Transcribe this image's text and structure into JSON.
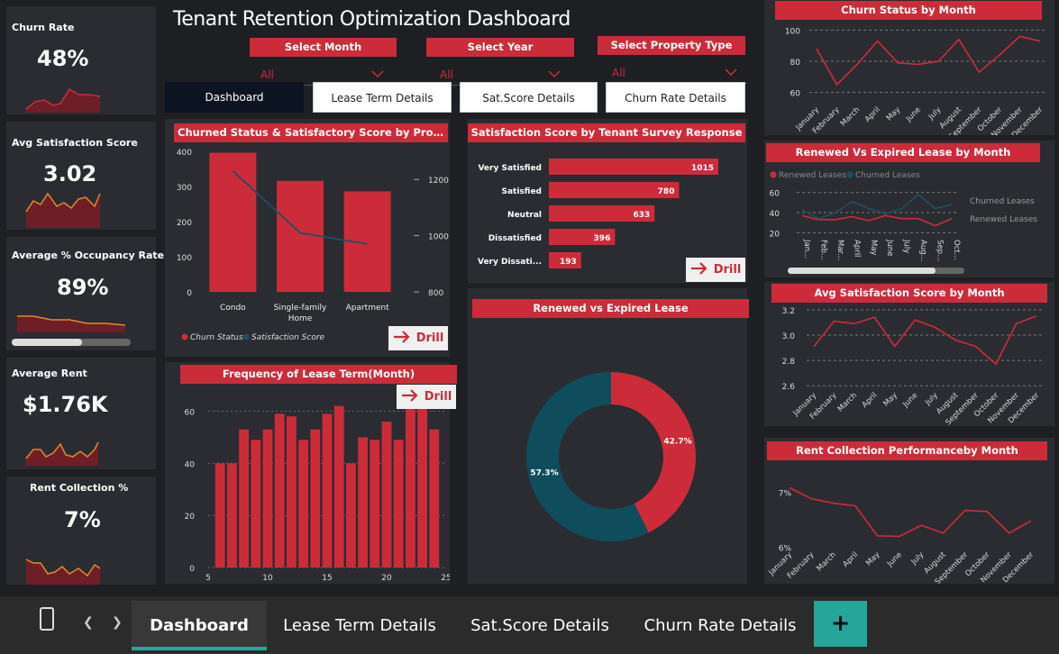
{
  "title": "Tenant Retention Optimization Dashboard",
  "filters": {
    "month": {
      "label": "Select Month",
      "value": "All"
    },
    "year": {
      "label": "Select Year",
      "value": "All"
    },
    "property": {
      "label": "Select Property Type",
      "value": "All"
    }
  },
  "nav": {
    "dashboard": "Dashboard",
    "lease": "Lease Term Details",
    "sat": "Sat.Score Details",
    "churn": "Churn Rate Details"
  },
  "kpis": {
    "churn": {
      "title": "Churn Rate",
      "value": "48%"
    },
    "sat": {
      "title": "Avg Satisfaction Score",
      "value": "3.02"
    },
    "occ": {
      "title": "Average % Occupancy Rate",
      "value": "89%"
    },
    "rent": {
      "title": "Average Rent",
      "value": "$1.76K"
    },
    "coll": {
      "title": "Rent Collection %",
      "value": "7%"
    }
  },
  "drill_label": "Drill",
  "colors": {
    "accent": "#cc2c3a",
    "teal": "#0f4c5c",
    "tab_accent": "#26a69a"
  },
  "chart_data": [
    {
      "id": "churn_sat_property",
      "type": "bar",
      "title": "Churned Status & Satisfactory Score by Property T...",
      "categories": [
        "Condo",
        "Single-family Home",
        "Apartment"
      ],
      "category_lines": [
        [
          "Condo"
        ],
        [
          "Single-family",
          "Home"
        ],
        [
          "Apartment"
        ]
      ],
      "series": [
        {
          "name": "Churn Status",
          "values": [
            396,
            316,
            286
          ],
          "color": "#cc2c3a"
        },
        {
          "name": "Satisfaction Score",
          "values": [
            1230,
            1010,
            970
          ],
          "color": "#1f4e66"
        }
      ],
      "ylim": [
        0,
        400
      ],
      "yticks": [
        "0",
        "100",
        "200",
        "300",
        "400"
      ],
      "y2lim": [
        800,
        1300
      ],
      "y2ticks": [
        "800",
        "1000",
        "1200"
      ],
      "y2tick_values": [
        800,
        1000,
        1200
      ]
    },
    {
      "id": "survey_response",
      "type": "bar",
      "title": "Satisfaction Score by Tenant Survey Response",
      "categories": [
        "Very Satisfied",
        "Satisfied",
        "Neutral",
        "Dissatisfied",
        "Very Dissati..."
      ],
      "values": [
        1015,
        780,
        633,
        396,
        193
      ],
      "labels": [
        "1015",
        "780",
        "633",
        "396",
        "193"
      ],
      "max": 1015
    },
    {
      "id": "lease_term",
      "type": "bar",
      "title": "Frequency of Lease Term(Month)",
      "x": [
        6,
        7,
        8,
        9,
        10,
        11,
        12,
        13,
        14,
        15,
        16,
        17,
        18,
        19,
        20,
        21,
        22,
        23,
        24
      ],
      "values": [
        40,
        40,
        53,
        49,
        53,
        59,
        58,
        49,
        53,
        59,
        62,
        40,
        50,
        49,
        56,
        49,
        64,
        64,
        53
      ],
      "ylim": [
        0,
        65
      ],
      "yticks": [
        "0",
        "20",
        "40",
        "60"
      ],
      "ytick_values": [
        0,
        20,
        40,
        60
      ],
      "xticks": [
        "5",
        "10",
        "15",
        "20",
        "25"
      ],
      "xtick_values": [
        5,
        10,
        15,
        20,
        25
      ]
    },
    {
      "id": "renewed_vs_expired",
      "type": "pie",
      "title": "Renewed vs Expired Lease",
      "slices": [
        {
          "value": 42.7,
          "label": "42.7%",
          "color": "#cc2c3a"
        },
        {
          "value": 57.3,
          "label": "57.3%",
          "color": "#0f4c5c"
        }
      ]
    },
    {
      "id": "churn_by_month",
      "type": "line",
      "title": "Churn Status by Month",
      "categories": [
        "January",
        "February",
        "March",
        "April",
        "May",
        "June",
        "July",
        "August",
        "September",
        "October",
        "November",
        "December"
      ],
      "values": [
        88,
        65,
        78,
        93,
        79,
        78,
        80,
        94,
        73,
        84,
        96,
        93
      ],
      "ylim": [
        58,
        102
      ],
      "yticks": [
        "60",
        "80",
        "100"
      ],
      "ytick_values": [
        60,
        80,
        100
      ]
    },
    {
      "id": "renewed_expired_month",
      "type": "line",
      "title": "Renewed Vs Expired Lease by Month",
      "categories": [
        "Jan...",
        "Feb...",
        "Mar...",
        "April",
        "May",
        "June",
        "July",
        "Aug...",
        "Sep...",
        "Oct..."
      ],
      "legend": [
        "Renewed Leases",
        "Churned Leases"
      ],
      "series": [
        {
          "name": "Renewed Leases",
          "values": [
            37,
            33,
            33,
            36,
            32,
            37,
            34,
            34,
            27,
            34
          ],
          "color": "#cc2c3a"
        },
        {
          "name": "Churned Leases",
          "values": [
            43,
            34,
            40,
            51,
            44,
            39,
            44,
            58,
            44,
            48
          ],
          "color": "#1f4e66"
        }
      ],
      "end_labels": [
        "Churned Leases",
        "Renewed Leases"
      ],
      "ylim": [
        15,
        65
      ],
      "yticks": [
        "20",
        "40",
        "60"
      ],
      "ytick_values": [
        20,
        40,
        60
      ]
    },
    {
      "id": "sat_by_month",
      "type": "line",
      "title": "Avg Satisfaction Score by Month",
      "categories": [
        "January",
        "February",
        "March",
        "April",
        "May",
        "June",
        "July",
        "August",
        "September",
        "October",
        "November",
        "December"
      ],
      "values": [
        2.91,
        3.11,
        3.09,
        3.14,
        2.91,
        3.12,
        3.06,
        2.96,
        2.91,
        2.77,
        3.09,
        3.15
      ],
      "ylim": [
        2.58,
        3.22
      ],
      "yticks": [
        "2.6",
        "2.8",
        "3.0",
        "3.2"
      ],
      "ytick_values": [
        2.6,
        2.8,
        3.0,
        3.2
      ]
    },
    {
      "id": "rent_collection_month",
      "type": "line",
      "title": "Rent Collection Performanceby Month",
      "categories": [
        "January",
        "February",
        "March",
        "April",
        "May",
        "June",
        "July",
        "August",
        "September",
        "October",
        "November",
        "December"
      ],
      "values": [
        7.08,
        6.88,
        6.8,
        6.75,
        6.21,
        6.2,
        6.4,
        6.26,
        6.67,
        6.65,
        6.26,
        6.48
      ],
      "ylim": [
        5.8,
        7.2
      ],
      "yticks": [
        "6%",
        "7%"
      ],
      "ytick_values": [
        6,
        7
      ]
    }
  ],
  "taskbar": {
    "tabs": [
      "Dashboard",
      "Lease Term Details",
      "Sat.Score Details",
      "Churn Rate Details"
    ],
    "add": "+"
  }
}
